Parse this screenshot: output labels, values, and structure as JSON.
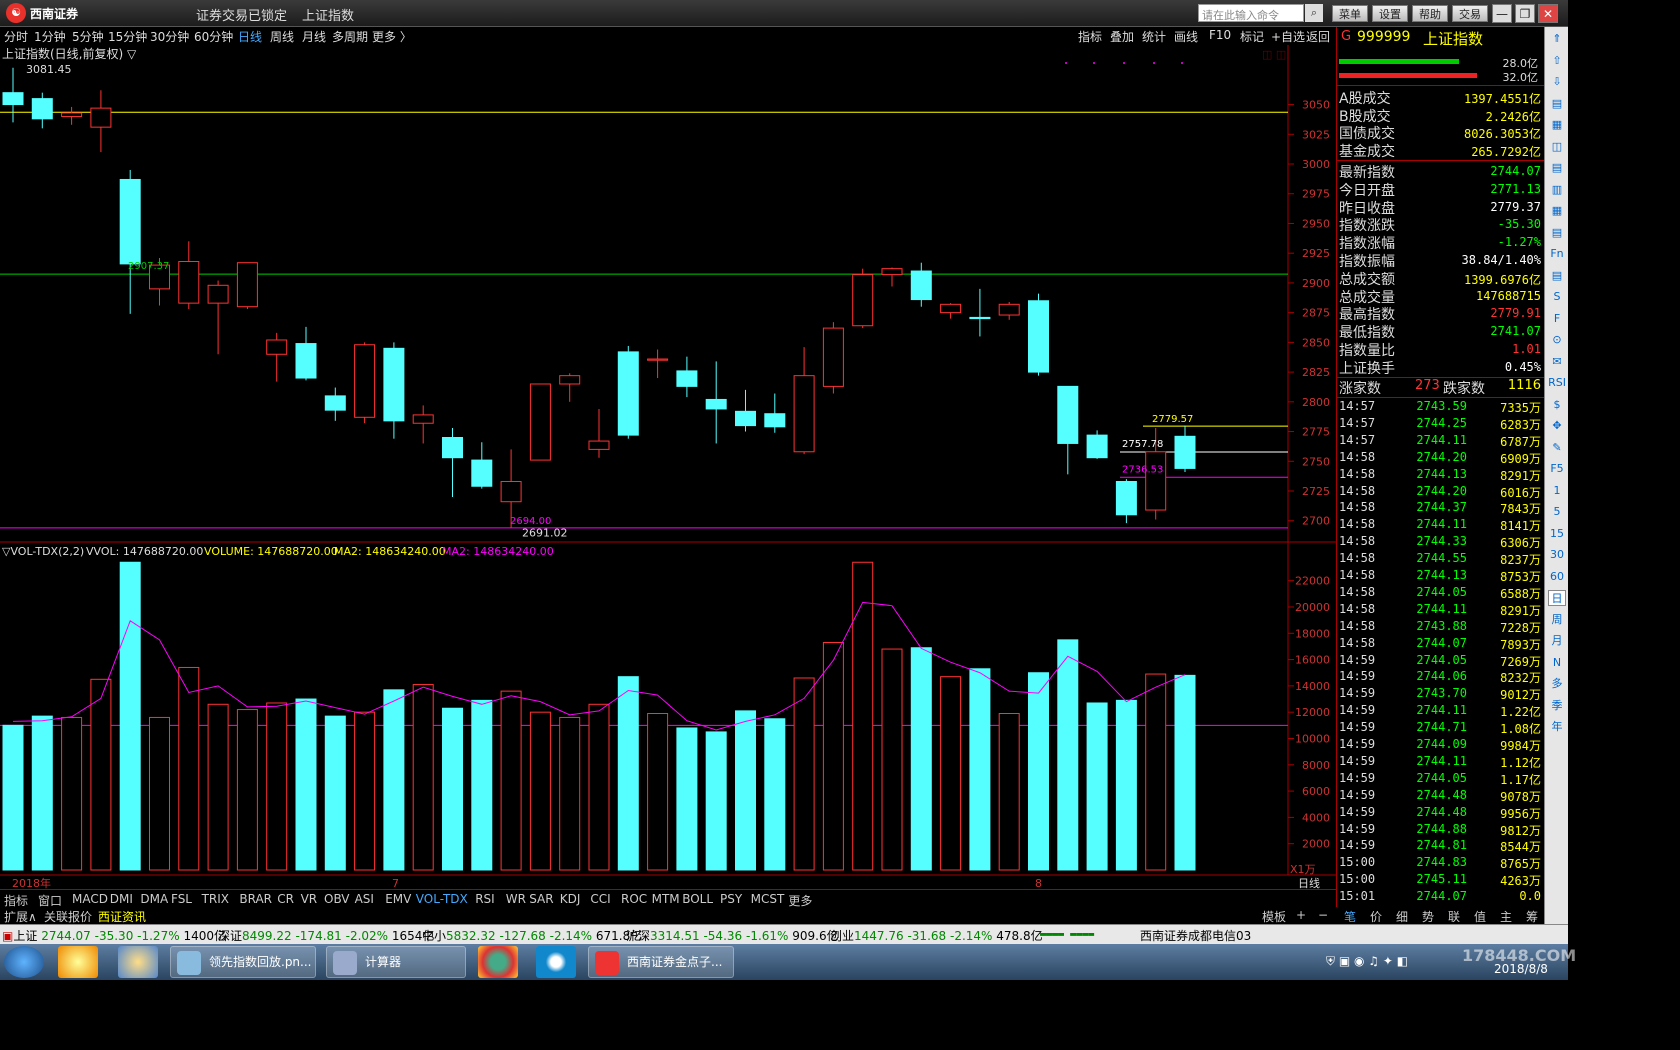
{
  "titlebar": {
    "logo": "西南证券",
    "status": "证券交易已锁定",
    "index_name": "上证指数",
    "cmd_placeholder": "请在此输入命令",
    "buttons": [
      "菜单",
      "设置",
      "帮助",
      "交易"
    ],
    "win": [
      "—",
      "❐",
      "✕"
    ]
  },
  "periods": [
    "分时",
    "1分钟",
    "5分钟",
    "15分钟",
    "30分钟",
    "60分钟",
    "日线",
    "周线",
    "月线",
    "多周期",
    "更多 〉"
  ],
  "selected_period": "日线",
  "right_tabs": [
    "指标",
    "叠加",
    "统计",
    "画线",
    "F10",
    "标记",
    "+自选",
    "返回"
  ],
  "chart": {
    "title": "上证指数(日线,前复权) ▽",
    "high_label": "3081.45",
    "low_label": "2691.02",
    "line_labels": {
      "green": "2907.37",
      "magenta": "2694.00",
      "yellow": "2779.57",
      "white": "2757.78",
      "pink": "2736.53"
    },
    "price_ticks": [
      "3050",
      "3025",
      "3000",
      "2975",
      "2950",
      "2925",
      "2900",
      "2875",
      "2850",
      "2825",
      "2800",
      "2775",
      "2750",
      "2725",
      "2700"
    ],
    "vol_header": {
      "name": "▽VOL-TDX(2,2)",
      "vvol": "VVOL: 147688720.00",
      "volume": "VOLUME: 147688720.00",
      "ma2a": "MA2: 148634240.00",
      "ma2b": "MA2: 148634240.00"
    },
    "vol_ticks": [
      "22000",
      "20000",
      "18000",
      "16000",
      "14000",
      "12000",
      "10000",
      "8000",
      "6000",
      "4000",
      "2000"
    ],
    "unit": "X1万",
    "period_label": "日线",
    "x_labels": [
      "2018年",
      "7",
      "8"
    ]
  },
  "chart_data": {
    "type": "candlestick",
    "candles": [
      [
        3060,
        3050,
        3081,
        3035
      ],
      [
        3055,
        3038,
        3060,
        3030
      ],
      [
        3040,
        3043,
        3048,
        3033
      ],
      [
        3031,
        3047,
        3062,
        3010
      ],
      [
        2987,
        2916,
        2995,
        2874
      ],
      [
        2895,
        2915,
        2921,
        2881
      ],
      [
        2883,
        2918,
        2935,
        2878
      ],
      [
        2883,
        2898,
        2902,
        2840
      ],
      [
        2880,
        2917,
        2916,
        2878
      ],
      [
        2840,
        2852,
        2858,
        2817
      ],
      [
        2849,
        2820,
        2863,
        2818
      ],
      [
        2805,
        2793,
        2812,
        2784
      ],
      [
        2787,
        2848,
        2850,
        2782
      ],
      [
        2845,
        2784,
        2850,
        2769
      ],
      [
        2782,
        2789,
        2797,
        2765
      ],
      [
        2770,
        2753,
        2778,
        2720
      ],
      [
        2751,
        2729,
        2766,
        2727
      ],
      [
        2716,
        2733,
        2760,
        2694
      ],
      [
        2751,
        2815,
        2809,
        2751
      ],
      [
        2815,
        2822,
        2824,
        2800
      ],
      [
        2760,
        2767,
        2794,
        2753
      ],
      [
        2842,
        2772,
        2847,
        2769
      ],
      [
        2835,
        2836,
        2844,
        2820
      ],
      [
        2826,
        2813,
        2838,
        2804
      ],
      [
        2802,
        2794,
        2834,
        2765
      ],
      [
        2792,
        2780,
        2810,
        2775
      ],
      [
        2790,
        2779,
        2807,
        2774
      ],
      [
        2758,
        2822,
        2846,
        2756
      ],
      [
        2813,
        2862,
        2867,
        2807
      ],
      [
        2864,
        2907,
        2912,
        2862
      ],
      [
        2907,
        2912,
        2913,
        2897
      ],
      [
        2910,
        2886,
        2917,
        2880
      ],
      [
        2875,
        2882,
        2883,
        2870
      ],
      [
        2871,
        2870,
        2895,
        2855
      ],
      [
        2873,
        2882,
        2884,
        2869
      ],
      [
        2885,
        2825,
        2891,
        2822
      ],
      [
        2813,
        2765,
        2810,
        2739
      ],
      [
        2772,
        2753,
        2776,
        2752
      ],
      [
        2733,
        2705,
        2735,
        2698
      ],
      [
        2709,
        2758,
        2778,
        2701
      ],
      [
        2771,
        2744,
        2780,
        2741
      ]
    ],
    "volume": [
      11000,
      11700,
      11600,
      14500,
      23400,
      11600,
      15400,
      12600,
      12200,
      12700,
      13000,
      11700,
      12000,
      13700,
      14100,
      12300,
      12900,
      13600,
      12000,
      11600,
      12600,
      14700,
      11900,
      10800,
      10500,
      12100,
      11500,
      14600,
      17300,
      23400,
      16800,
      16900,
      14700,
      15300,
      11900,
      15000,
      17500,
      12700,
      12900,
      14900,
      14800
    ],
    "ma2": [
      11300,
      11350,
      11650,
      13050,
      18950,
      17500,
      13500,
      14000,
      12400,
      12450,
      12850,
      12350,
      11850,
      12850,
      13900,
      13200,
      12600,
      13250,
      12800,
      11800,
      12100,
      13650,
      13300,
      11350,
      10650,
      11300,
      11800,
      13050,
      15950,
      20350,
      20100,
      16850,
      15800,
      15000,
      13600,
      13450,
      16250,
      15100,
      12800,
      13900,
      14850
    ],
    "ylim": [
      2688,
      3090
    ],
    "vol_max": 23800
  },
  "rp": {
    "code": "999999",
    "name": "上证指数",
    "g": "G",
    "bar_top": "28.0亿",
    "bar_bot": "32.0亿",
    "stats": [
      [
        "A股成交",
        "1397.4551亿"
      ],
      [
        "B股成交",
        "2.2426亿"
      ],
      [
        "国债成交",
        "8026.3053亿"
      ],
      [
        "基金成交",
        "265.7292亿"
      ]
    ],
    "quotes": [
      [
        "最新指数",
        "2744.07"
      ],
      [
        "今日开盘",
        "2771.13"
      ],
      [
        "昨日收盘",
        "2779.37"
      ],
      [
        "指数涨跌",
        "-35.30"
      ],
      [
        "指数涨幅",
        "-1.27%"
      ],
      [
        "指数振幅",
        "38.84/1.40%"
      ],
      [
        "总成交额",
        "1399.6976亿"
      ],
      [
        "总成交量",
        "147688715"
      ],
      [
        "最高指数",
        "2779.91"
      ],
      [
        "最低指数",
        "2741.07"
      ],
      [
        "指数量比",
        "1.01"
      ],
      [
        "上证换手",
        "0.45%"
      ]
    ],
    "updown": {
      "up_label": "涨家数",
      "up": "273",
      "down_label": "跌家数",
      "down": "1116"
    },
    "ticks": [
      [
        "14:57",
        "2743.59",
        "7335万"
      ],
      [
        "14:57",
        "2744.25",
        "6283万"
      ],
      [
        "14:57",
        "2744.11",
        "6787万"
      ],
      [
        "14:58",
        "2744.20",
        "6909万"
      ],
      [
        "14:58",
        "2744.13",
        "8291万"
      ],
      [
        "14:58",
        "2744.20",
        "6016万"
      ],
      [
        "14:58",
        "2744.37",
        "7843万"
      ],
      [
        "14:58",
        "2744.11",
        "8141万"
      ],
      [
        "14:58",
        "2744.33",
        "6306万"
      ],
      [
        "14:58",
        "2744.55",
        "8237万"
      ],
      [
        "14:58",
        "2744.13",
        "8753万"
      ],
      [
        "14:58",
        "2744.05",
        "6588万"
      ],
      [
        "14:58",
        "2744.11",
        "8291万"
      ],
      [
        "14:58",
        "2743.88",
        "7228万"
      ],
      [
        "14:58",
        "2744.07",
        "7893万"
      ],
      [
        "14:59",
        "2744.05",
        "7269万"
      ],
      [
        "14:59",
        "2744.06",
        "8232万"
      ],
      [
        "14:59",
        "2743.70",
        "9012万"
      ],
      [
        "14:59",
        "2744.11",
        "1.22亿"
      ],
      [
        "14:59",
        "2744.71",
        "1.08亿"
      ],
      [
        "14:59",
        "2744.09",
        "9984万"
      ],
      [
        "14:59",
        "2744.11",
        "1.12亿"
      ],
      [
        "14:59",
        "2744.05",
        "1.17亿"
      ],
      [
        "14:59",
        "2744.48",
        "9078万"
      ],
      [
        "14:59",
        "2744.48",
        "9956万"
      ],
      [
        "14:59",
        "2744.88",
        "9812万"
      ],
      [
        "14:59",
        "2744.81",
        "8544万"
      ],
      [
        "15:00",
        "2744.83",
        "8765万"
      ],
      [
        "15:00",
        "2745.11",
        "4263万"
      ],
      [
        "15:01",
        "2744.07",
        "0.0"
      ]
    ],
    "tabs": [
      "笔",
      "价",
      "细",
      "势",
      "联",
      "值",
      "主",
      "筹"
    ]
  },
  "rbar": [
    "⇑",
    "⇧",
    "⇩",
    "▤",
    "▦",
    "◫",
    "▤",
    "▥",
    "▦",
    "▤",
    "Fn",
    "▤",
    "S",
    "F",
    "⊙",
    "✉",
    "RSI",
    "$",
    "✥",
    "✎",
    "F5",
    "1",
    "5",
    "15",
    "30",
    "60",
    "日",
    "周",
    "月",
    "N",
    "多",
    "季",
    "年"
  ],
  "indicators": [
    "指标",
    "窗口",
    "MACD",
    "DMI",
    "DMA",
    "FSL",
    "TRIX",
    "BRAR",
    "CR",
    "VR",
    "OBV",
    "ASI",
    "EMV",
    "VOL-TDX",
    "RSI",
    "WR",
    "SAR",
    "KDJ",
    "CCI",
    "ROC",
    "MTM",
    "BOLL",
    "PSY",
    "MCST",
    "更多"
  ],
  "selected_indicator": "VOL-TDX",
  "bottom2": {
    "expand": "扩展∧",
    "related": "关联报价",
    "news": "西证资讯",
    "template": "模板",
    "plus": "+",
    "minus": "−"
  },
  "status": {
    "sh": "上证",
    "sh_v": "2744.07",
    "sh_c": "-35.30",
    "sh_p": "-1.27%",
    "sh_a": "1400亿",
    "sz": "深证",
    "sz_v": "8499.22",
    "sz_c": "-174.81",
    "sz_p": "-2.02%",
    "sz_a": "1654亿",
    "zx": "中小",
    "zx_v": "5832.32",
    "zx_c": "-127.68",
    "zx_p": "-2.14%",
    "zx_a": "671.8亿",
    "hs": "沪深",
    "hs_v": "3314.51",
    "hs_c": "-54.36",
    "hs_p": "-1.61%",
    "hs_a": "909.6亿",
    "cy": "创业",
    "cy_v": "1447.76",
    "cy_c": "-31.68",
    "cy_p": "-2.14%",
    "cy_a": "478.8亿",
    "broker": "西南证券成都电信03"
  },
  "taskbar": {
    "apps": [
      "领先指数回放.pn...",
      "计算器",
      "西南证券金点子..."
    ],
    "date": "2018/8/8",
    "watermark": "178448.COM"
  }
}
